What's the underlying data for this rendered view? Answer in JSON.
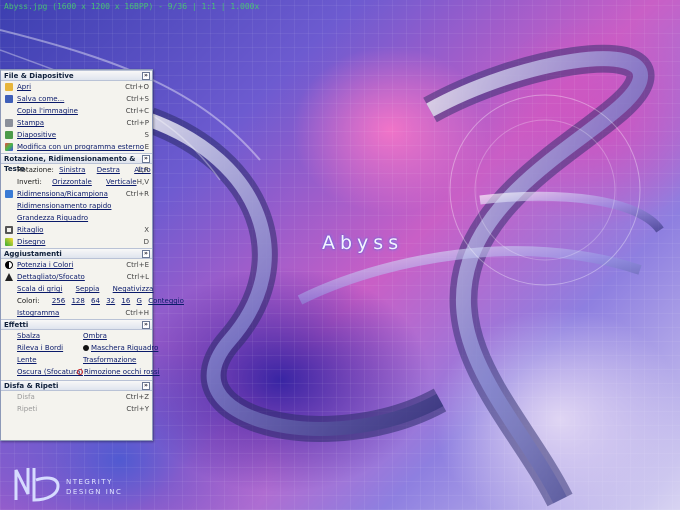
{
  "window": {
    "title": "Abyss.jpg (1600 x 1200 x 16BPP) - 9/36 | 1:1 | 1.000x"
  },
  "wallpaper": {
    "text": "Abyss",
    "logo_line1": "NTEGRITY",
    "logo_line2": "DESIGN INC"
  },
  "panel": {
    "file": {
      "title": "File & Diapositive",
      "items": [
        {
          "label": "Apri",
          "shortcut": "Ctrl+O"
        },
        {
          "label": "Salva come...",
          "shortcut": "Ctrl+S"
        },
        {
          "label": "Copia l'immagine",
          "shortcut": "Ctrl+C"
        },
        {
          "label": "Stampa",
          "shortcut": "Ctrl+P"
        },
        {
          "label": "Diapositive",
          "shortcut": "S"
        },
        {
          "label": "Modifica con un programma esterno",
          "shortcut": "E"
        }
      ]
    },
    "rotate": {
      "title": "Rotazione, Ridimensionamento  & Testo",
      "rotation_label": "Rotazione:",
      "rotation_opts": [
        "Sinistra",
        "Destra",
        "Altro"
      ],
      "rotation_shortcut": "L,R",
      "flip_label": "Invertì:",
      "flip_opts": [
        "Orizzontale",
        "Verticale"
      ],
      "flip_shortcut": "H,V",
      "resize": {
        "label": "Ridimensiona/Ricampiona",
        "shortcut": "Ctrl+R"
      },
      "quick_resize": "Ridimensionamento rapido",
      "crop_size": "Grandezza Riquadro",
      "crop": {
        "label": "Ritaglio",
        "shortcut": "X"
      },
      "draw": {
        "label": "Disegno",
        "shortcut": "D"
      }
    },
    "adjust": {
      "title": "Aggiustamenti",
      "colors_power": {
        "label": "Potenzia i Colori",
        "shortcut": "Ctrl+E"
      },
      "detail": {
        "label": "Dettagliato/Sfocato",
        "shortcut": "Ctrl+L"
      },
      "gray_opts": [
        "Scala di grigi",
        "Seppia",
        "Negativizza"
      ],
      "colors_label": "Colori:",
      "color_counts": [
        "256",
        "128",
        "64",
        "32",
        "16",
        "G"
      ],
      "count_label": "Conteggio",
      "histogram": {
        "label": "Istogramma",
        "shortcut": "Ctrl+H"
      }
    },
    "effects": {
      "title": "Effetti",
      "rows": [
        [
          "Sbalza",
          "Ombra"
        ],
        [
          "Rileva i Bordi",
          "Maschera Riquadro"
        ],
        [
          "Lente",
          "Trasformazione"
        ],
        [
          "Oscura (Sfocatura)",
          "Rimozione occhi rossi"
        ]
      ]
    },
    "undo": {
      "title": "Disfa & Ripeti",
      "undo": {
        "label": "Disfa",
        "shortcut": "Ctrl+Z"
      },
      "redo": {
        "label": "Ripeti",
        "shortcut": "Ctrl+Y"
      }
    },
    "collapse_glyph": "»"
  },
  "colors": {
    "accent_link": "#0a1a6a",
    "panel_bg": "#f4f3ee",
    "titlebar_text": "#46d46a"
  }
}
